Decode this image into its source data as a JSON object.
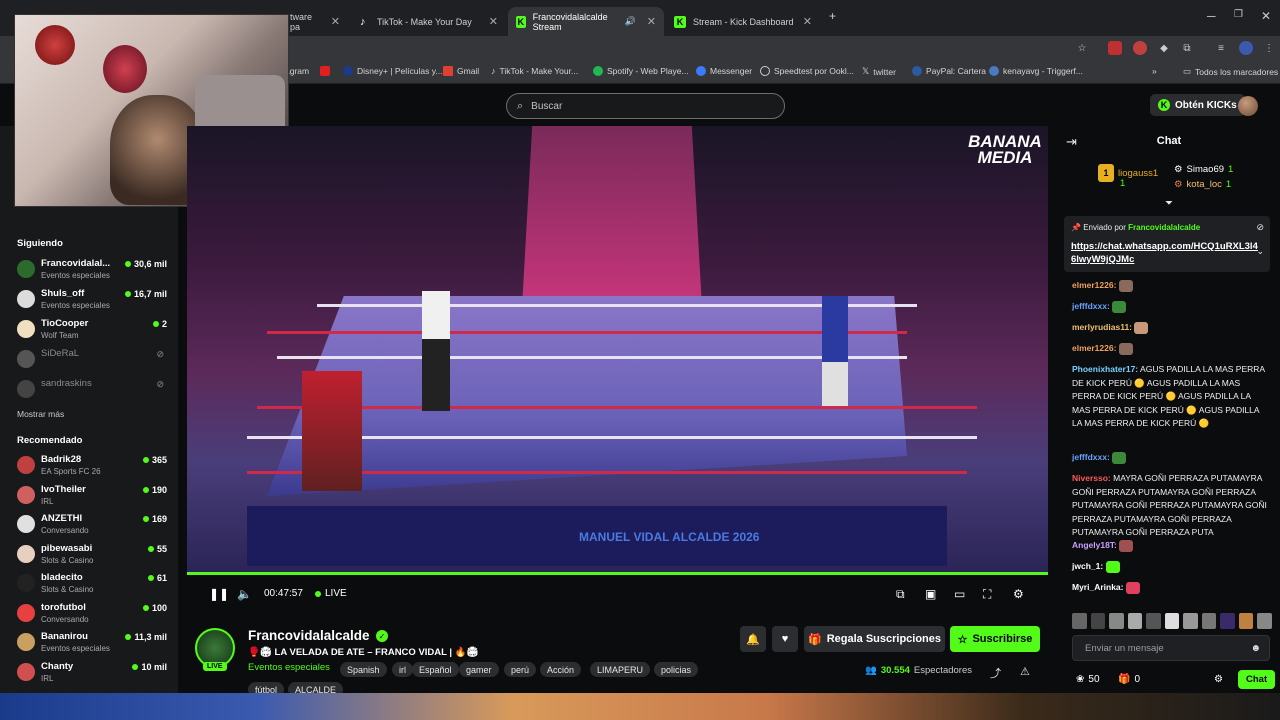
{
  "browser": {
    "tabs": [
      {
        "label": "tware pa",
        "icon": "",
        "active": false
      },
      {
        "label": "TikTok - Make Your Day",
        "icon": "tiktok-icon",
        "active": false
      },
      {
        "label": "Francovidalalcalde Stream",
        "icon": "kick-icon",
        "active": true
      },
      {
        "label": "Stream - Kick Dashboard",
        "icon": "kick-icon",
        "active": false
      }
    ],
    "new_tab": "+",
    "bookmarks": [
      "agram",
      "Disney+ | Películas y...",
      "Gmail",
      "TikTok - Make Your...",
      "Spotify - Web Playe...",
      "Messenger",
      "Speedtest por Ookl...",
      "twitter",
      "PayPal: Cartera",
      "kenayavg - Triggerf..."
    ],
    "all_bookmarks": "Todos los marcadores"
  },
  "header": {
    "search_placeholder": "Buscar",
    "kicks_button": "Obtén KICKs"
  },
  "sidebar": {
    "following_title": "Siguiendo",
    "following": [
      {
        "name": "Francovidalal...",
        "category": "Eventos especiales",
        "viewers": "30,6 mil",
        "live": true,
        "color": "#2d6b2d"
      },
      {
        "name": "Shuls_off",
        "category": "Eventos especiales",
        "viewers": "16,7 mil",
        "live": true,
        "color": "#dcdcdc"
      },
      {
        "name": "TioCooper",
        "category": "Wolf Team",
        "viewers": "2",
        "live": true,
        "color": "#f0e0c0"
      },
      {
        "name": "SiDeRaL",
        "category": "",
        "viewers": "",
        "live": false,
        "color": "#555"
      },
      {
        "name": "sandraskins",
        "category": "",
        "viewers": "",
        "live": false,
        "color": "#444"
      }
    ],
    "show_more": "Mostrar más",
    "recommended_title": "Recomendado",
    "recommended": [
      {
        "name": "Badrik28",
        "category": "EA Sports FC 26",
        "viewers": "365",
        "color": "#c04040"
      },
      {
        "name": "IvoTheiler",
        "category": "IRL",
        "viewers": "190",
        "color": "#d06060"
      },
      {
        "name": "ANZETHI",
        "category": "Conversando",
        "viewers": "169",
        "color": "#e0e0e0"
      },
      {
        "name": "pibewasabi",
        "category": "Slots & Casino",
        "viewers": "55",
        "color": "#e8d0c0"
      },
      {
        "name": "bladecito",
        "category": "Slots & Casino",
        "viewers": "61",
        "color": "#222"
      },
      {
        "name": "torofutbol",
        "category": "Conversando",
        "viewers": "100",
        "color": "#e84040"
      },
      {
        "name": "Bananirou",
        "category": "Eventos especiales",
        "viewers": "11,3 mil",
        "color": "#c8a060"
      },
      {
        "name": "Chanty",
        "category": "IRL",
        "viewers": "10 mil",
        "color": "#d05050"
      }
    ]
  },
  "player": {
    "watermark": "BANANA MEDIA",
    "time": "00:47:57",
    "live_label": "LIVE",
    "banner_text": "MANUEL VIDAL ALCALDE 2026"
  },
  "stream": {
    "channel": "Francovidalalcalde",
    "live_badge": "LIVE",
    "title": "🥊🏟 LA VELADA DE ATE – FRANCO VIDAL | 🔥🏟",
    "category": "Eventos especiales",
    "tags": [
      "Spanish",
      "irl",
      "Español",
      "gamer",
      "perú",
      "Acción",
      "LIMAPERU",
      "policias",
      "fútbol",
      "ALCALDE"
    ],
    "gift_button": "Regala Suscripciones",
    "subscribe_button": "Suscribirse",
    "viewers_count": "30.554",
    "viewers_label": "Espectadores"
  },
  "chat": {
    "title": "Chat",
    "leaderboard": [
      {
        "rank": "1",
        "name": "liogauss1",
        "count": "1"
      },
      {
        "name": "Simao69",
        "count": "1"
      },
      {
        "name": "kota_loc",
        "count": "1"
      }
    ],
    "pinned_by_label": "Enviado por",
    "pinned_by_user": "Francovidalalcalde",
    "pinned_url": "https://chat.whatsapp.com/HCQ1uRXL3l46lwyW9jQJMc",
    "messages": [
      {
        "user": "elmer1226:",
        "text": "",
        "color": "#f0a060",
        "emote": "#8a6a5a"
      },
      {
        "user": "jefffdxxx:",
        "text": "",
        "color": "#6aa0ff",
        "emote": "#3a8a3a"
      },
      {
        "user": "merlyrudias11:",
        "text": "",
        "color": "#f0c070",
        "emote": "#c89878"
      },
      {
        "user": "elmer1226:",
        "text": "",
        "color": "#f0a060",
        "emote": "#8a6a5a"
      },
      {
        "user": "Phoenixhater17:",
        "text": "AGUS PADILLA LA MAS PERRA DE KICK PERÚ 🟡 AGUS PADILLA LA MAS PERRA DE KICK PERÚ 🟡 AGUS PADILLA LA MAS PERRA DE KICK PERÚ 🟡 AGUS PADILLA LA MAS PERRA DE KICK PERÚ 🟡",
        "color": "#7ad0ff",
        "emote": ""
      },
      {
        "user": "jefffdxxx:",
        "text": "",
        "color": "#6aa0ff",
        "emote": "#3a8a3a"
      },
      {
        "user": "Niversso:",
        "text": "MAYRA GOÑI PERRAZA PUTAMAYRA GOÑI PERRAZA PUTAMAYRA GOÑI PERRAZA PUTAMAYRA GOÑI PERRAZA PUTAMAYRA GOÑI PERRAZA PUTAMAYRA GOÑI PERRAZA PUTAMAYRA GOÑI PERRAZA PUTA",
        "color": "#ff5a5a",
        "emote": ""
      },
      {
        "user": "Angely18T:",
        "text": "",
        "color": "#c9a0ff",
        "emote": "#a05050"
      },
      {
        "user": "jwch_1:",
        "text": "",
        "color": "#ffffff",
        "emote": "#53fc18"
      },
      {
        "user": "Myri_Arinka:",
        "text": "",
        "color": "#ffffff",
        "emote": "#e04060"
      }
    ],
    "input_placeholder": "Enviar un mensaje",
    "points": "50",
    "gifts": "0",
    "chat_button": "Chat"
  }
}
